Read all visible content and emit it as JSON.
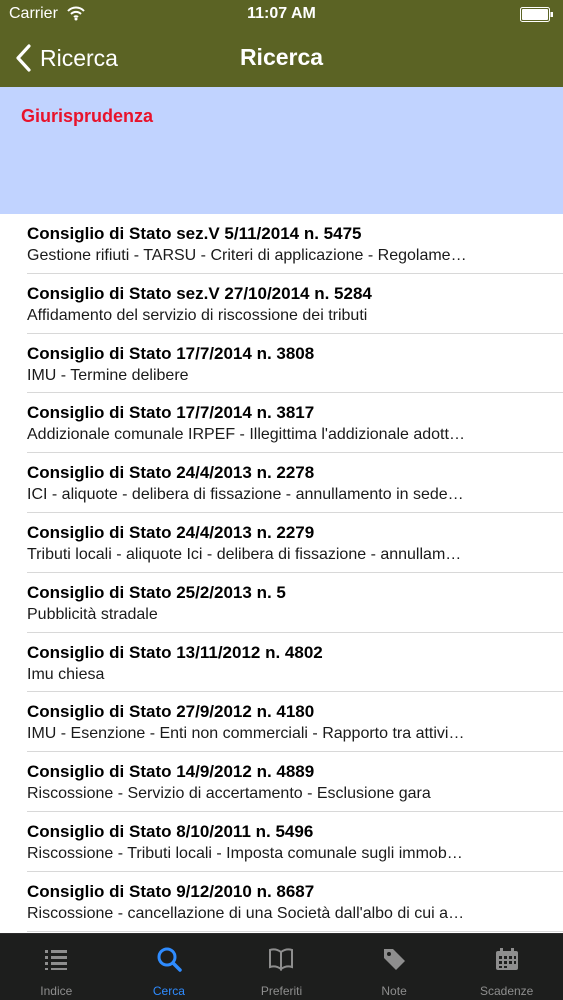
{
  "status_bar": {
    "carrier": "Carrier",
    "time": "11:07 AM",
    "icons": [
      "wifi-icon",
      "battery-icon"
    ]
  },
  "nav_bar": {
    "back_label": "Ricerca",
    "title": "Ricerca",
    "background_color": "#5b6324"
  },
  "section": {
    "title": "Giurisprudenza",
    "title_color": "#e8132c",
    "background_color": "#c1d3ff"
  },
  "results": [
    {
      "title": "Consiglio di Stato sez.V 5/11/2014 n. 5475",
      "subtitle": "Gestione rifiuti - TARSU - Criteri di applicazione - Regolame…"
    },
    {
      "title": "Consiglio di Stato sez.V 27/10/2014 n. 5284",
      "subtitle": "Affidamento del servizio di riscossione dei tributi"
    },
    {
      "title": "Consiglio di Stato 17/7/2014 n. 3808",
      "subtitle": "IMU - Termine delibere"
    },
    {
      "title": "Consiglio di Stato 17/7/2014 n. 3817",
      "subtitle": "Addizionale comunale IRPEF - Illegittima l'addizionale adott…"
    },
    {
      "title": "Consiglio di Stato 24/4/2013 n. 2278",
      "subtitle": "ICI - aliquote - delibera di fissazione - annullamento in sede…"
    },
    {
      "title": "Consiglio di Stato 24/4/2013 n. 2279",
      "subtitle": "Tributi locali - aliquote Ici - delibera di fissazione - annullam…"
    },
    {
      "title": "Consiglio di Stato 25/2/2013 n. 5",
      "subtitle": "Pubblicità stradale"
    },
    {
      "title": "Consiglio di Stato 13/11/2012 n. 4802",
      "subtitle": "Imu chiesa"
    },
    {
      "title": "Consiglio di Stato 27/9/2012 n. 4180",
      "subtitle": "IMU - Esenzione - Enti non commerciali - Rapporto tra attivi…"
    },
    {
      "title": "Consiglio di Stato 14/9/2012 n. 4889",
      "subtitle": "Riscossione - Servizio di accertamento - Esclusione gara"
    },
    {
      "title": "Consiglio di Stato 8/10/2011 n. 5496",
      "subtitle": "Riscossione - Tributi locali - Imposta comunale sugli immob…"
    },
    {
      "title": "Consiglio di Stato 9/12/2010 n. 8687",
      "subtitle": "Riscossione - cancellazione di una Società dall'albo di cui a…"
    }
  ],
  "tab_bar": {
    "active_color": "#2f8cff",
    "tabs": [
      {
        "label": "Indice",
        "icon": "list-icon",
        "active": false
      },
      {
        "label": "Cerca",
        "icon": "search-icon",
        "active": true
      },
      {
        "label": "Preferiti",
        "icon": "book-icon",
        "active": false
      },
      {
        "label": "Note",
        "icon": "tag-icon",
        "active": false
      },
      {
        "label": "Scadenze",
        "icon": "calendar-icon",
        "active": false
      }
    ]
  }
}
